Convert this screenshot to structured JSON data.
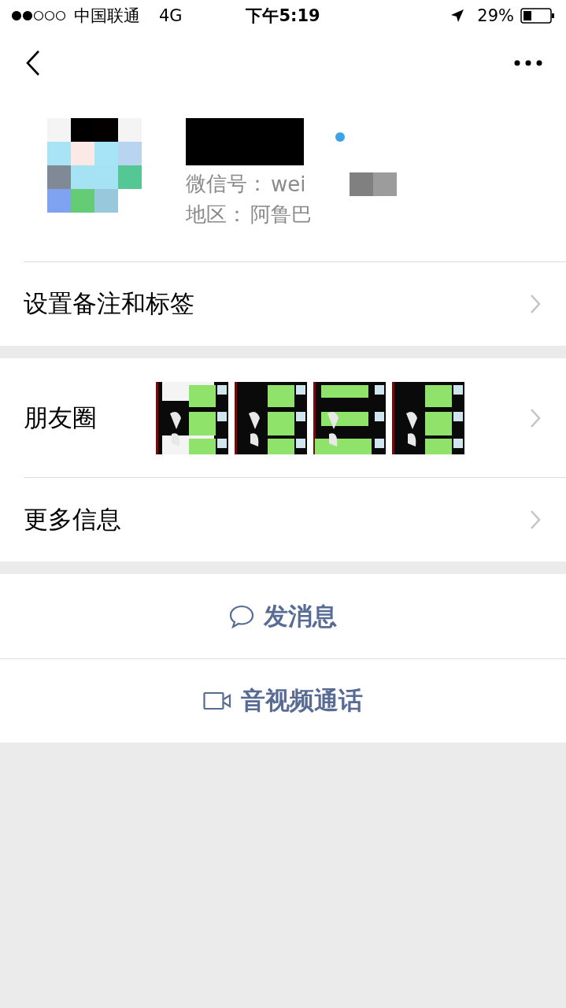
{
  "status_bar": {
    "carrier": "中国联通",
    "network": "4G",
    "time": "下午5:19",
    "battery": "29%"
  },
  "profile": {
    "wechat_id_label": "微信号：",
    "wechat_id": "wei",
    "region_label": "地区：",
    "region": "阿鲁巴"
  },
  "sections": [
    {
      "rows": [
        {
          "kind": "link",
          "label": "设置备注和标签"
        }
      ]
    },
    {
      "rows": [
        {
          "kind": "photos",
          "label": "朋友圈"
        },
        {
          "kind": "link",
          "label": "更多信息"
        }
      ]
    }
  ],
  "actions": [
    {
      "kind": "chat",
      "label": "发消息"
    },
    {
      "kind": "video",
      "label": "音视频通话"
    }
  ]
}
